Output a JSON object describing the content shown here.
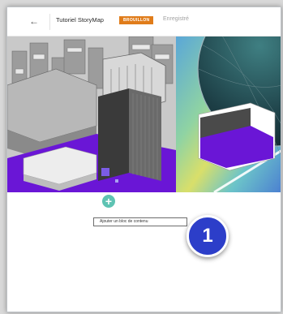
{
  "header": {
    "back_icon": "arrow-left-icon",
    "title": "Tutoriel StoryMap",
    "status_badge": "BROUILLON",
    "save_status": "Enregistré"
  },
  "content": {
    "add_block_tooltip": "Ajouter un bloc de contenu",
    "add_icon": "plus-icon"
  },
  "callout": {
    "step_number": "1"
  },
  "colors": {
    "accent_teal": "#5ec3b3",
    "badge_orange": "#e07c1a",
    "callout_blue": "#2c3ec9",
    "banner_purple": "#6a16d6"
  }
}
